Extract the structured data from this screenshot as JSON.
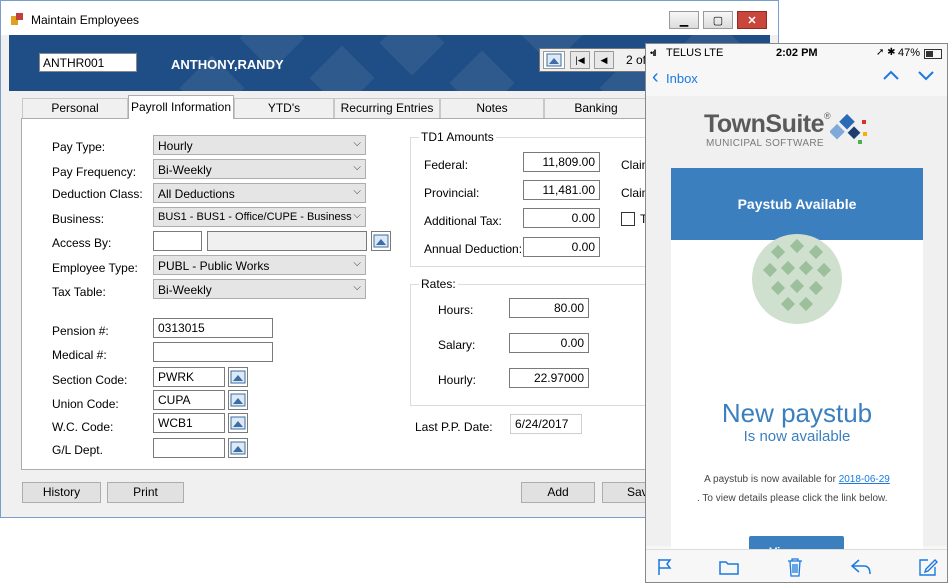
{
  "window": {
    "title": "Maintain Employees",
    "min": "▁",
    "max": "▢",
    "close": "✕"
  },
  "banner": {
    "employee_id": "ANTHR001",
    "employee_name": "ANTHONY,RANDY",
    "record_position": "2 of"
  },
  "tabs": [
    {
      "label": "Personal Information"
    },
    {
      "label": "Payroll Information"
    },
    {
      "label": "YTD's"
    },
    {
      "label": "Recurring Entries"
    },
    {
      "label": "Notes"
    },
    {
      "label": "Banking"
    }
  ],
  "form": {
    "pay_type": {
      "label": "Pay Type:",
      "value": "Hourly"
    },
    "pay_frequency": {
      "label": "Pay Frequency:",
      "value": "Bi-Weekly"
    },
    "deduction_class": {
      "label": "Deduction Class:",
      "value": "All Deductions"
    },
    "business": {
      "label": "Business:",
      "value": "BUS1 - BUS1 - Office/CUPE - Business"
    },
    "access_by": {
      "label": "Access By:",
      "value": "",
      "desc": ""
    },
    "employee_type": {
      "label": "Employee Type:",
      "value": "PUBL - Public Works"
    },
    "tax_table": {
      "label": "Tax Table:",
      "value": "Bi-Weekly"
    },
    "pension": {
      "label": "Pension #:",
      "value": "0313015"
    },
    "medical": {
      "label": "Medical #:",
      "value": ""
    },
    "section_code": {
      "label": "Section Code:",
      "value": "PWRK"
    },
    "union_code": {
      "label": "Union Code:",
      "value": "CUPA"
    },
    "wc_code": {
      "label": "W.C. Code:",
      "value": "WCB1"
    },
    "gl_dept": {
      "label": "G/L Dept.",
      "value": ""
    }
  },
  "td1": {
    "title": "TD1 Amounts",
    "federal": {
      "label": "Federal:",
      "value": "11,809.00"
    },
    "provincial": {
      "label": "Provincial:",
      "value": "11,481.00"
    },
    "additional_tax": {
      "label": "Additional Tax:",
      "value": "0.00"
    },
    "annual_deduction": {
      "label": "Annual Deduction:",
      "value": "0.00"
    },
    "claim1": "Claim",
    "claim2": "Claim",
    "check_label": "T"
  },
  "rates": {
    "title": "Rates:",
    "hours": {
      "label": "Hours:",
      "value": "80.00"
    },
    "salary": {
      "label": "Salary:",
      "value": "0.00"
    },
    "hourly": {
      "label": "Hourly:",
      "value": "22.97000"
    }
  },
  "last_pp": {
    "label": "Last P.P. Date:",
    "value": "6/24/2017"
  },
  "buttons": {
    "history": "History",
    "print": "Print",
    "add": "Add",
    "save": "Sav"
  },
  "phone": {
    "carrier": "TELUS",
    "network": "LTE",
    "time": "2:02 PM",
    "battery": "47%",
    "back_label": "Inbox",
    "brand": "TownSuite",
    "brand_reg": "®",
    "brand_sub": "MUNICIPAL SOFTWARE",
    "card_title": "Paystub Available",
    "headline": "New paystub",
    "subheadline": "Is now available",
    "body_prefix": "A paystub is now available for ",
    "body_date": "2018-06-29",
    "body_suffix": ". To view details please click the link below.",
    "cta": "View now",
    "accent": "#3b7fbf"
  }
}
